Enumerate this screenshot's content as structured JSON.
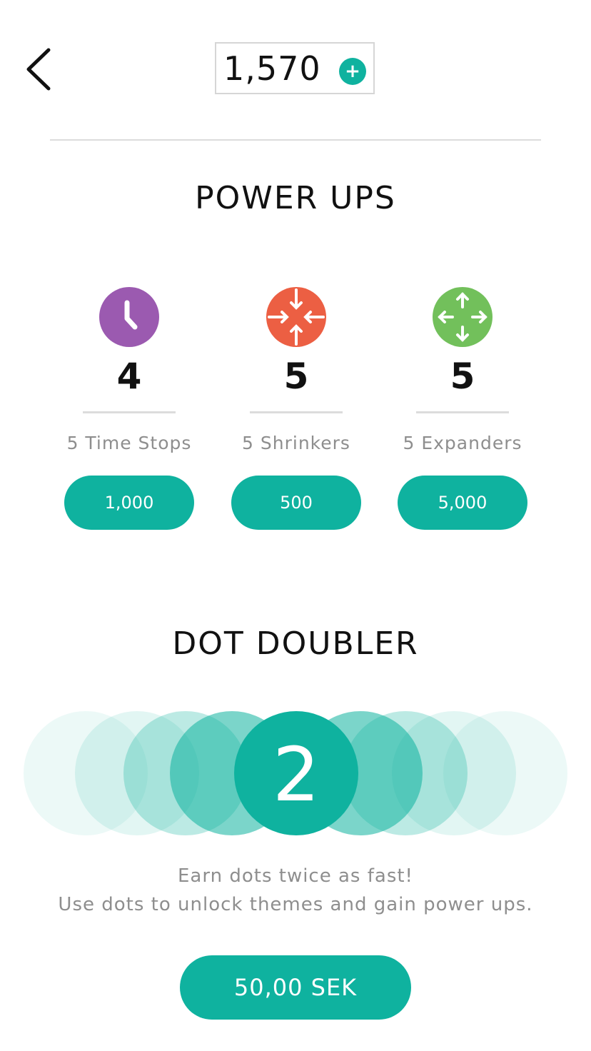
{
  "header": {
    "back_icon": "chevron-left-icon",
    "balance": "1,570",
    "add_label": "+",
    "accent_color": "#0fb29f"
  },
  "powerups": {
    "title": "POWER UPS",
    "items": [
      {
        "icon": "clock-icon",
        "icon_color": "#9b5ab0",
        "count": "4",
        "description": "5 Time Stops",
        "price": "1,000"
      },
      {
        "icon": "shrink-arrows-icon",
        "icon_color": "#ec5f43",
        "count": "5",
        "description": "5 Shrinkers",
        "price": "500"
      },
      {
        "icon": "expand-arrows-icon",
        "icon_color": "#72c05b",
        "count": "5",
        "description": "5 Expanders",
        "price": "5,000"
      }
    ]
  },
  "doubler": {
    "title": "DOT DOUBLER",
    "multiplier": "2",
    "description_line1": "Earn dots twice as fast!",
    "description_line2": "Use dots to unlock themes and gain power ups.",
    "price": "50,00 SEK"
  }
}
